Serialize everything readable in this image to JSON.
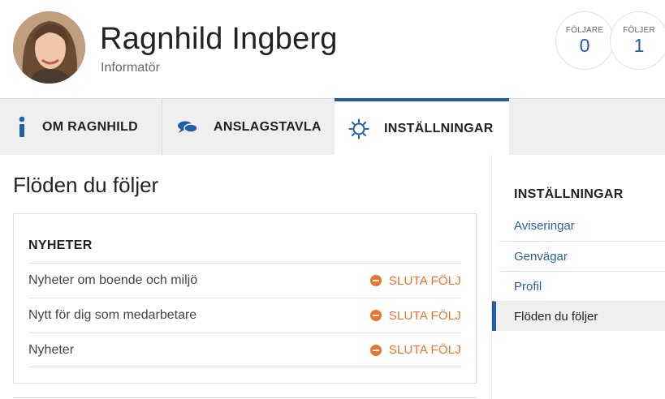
{
  "profile": {
    "name": "Ragnhild Ingberg",
    "role": "Informatör",
    "avatar_alt": "avatar"
  },
  "stats": {
    "followers_label": "FÖLJARE",
    "followers_value": "0",
    "following_label": "FÖLJER",
    "following_value": "1"
  },
  "tabs": [
    {
      "label": "OM RAGNHILD",
      "icon": "info-icon"
    },
    {
      "label": "ANSLAGSTAVLA",
      "icon": "speech-bubbles-icon"
    },
    {
      "label": "INSTÄLLNINGAR",
      "icon": "gear-icon",
      "active": true
    }
  ],
  "main": {
    "title": "Flöden du följer",
    "section_heading": "NYHETER",
    "feeds": [
      {
        "name": "Nyheter om boende och miljö",
        "action": "SLUTA FÖLJ"
      },
      {
        "name": "Nytt för dig som medarbetare",
        "action": "SLUTA FÖLJ"
      },
      {
        "name": "Nyheter",
        "action": "SLUTA FÖLJ"
      }
    ]
  },
  "sidebar": {
    "heading": "INSTÄLLNINGAR",
    "items": [
      {
        "label": "Aviseringar"
      },
      {
        "label": "Genvägar"
      },
      {
        "label": "Profil"
      },
      {
        "label": "Flöden du följer",
        "active": true
      }
    ]
  },
  "colors": {
    "accent_blue": "#1f5fa8",
    "link_blue": "#2b5f9e",
    "orange": "#e9742a",
    "tab_bg": "#efefef"
  }
}
